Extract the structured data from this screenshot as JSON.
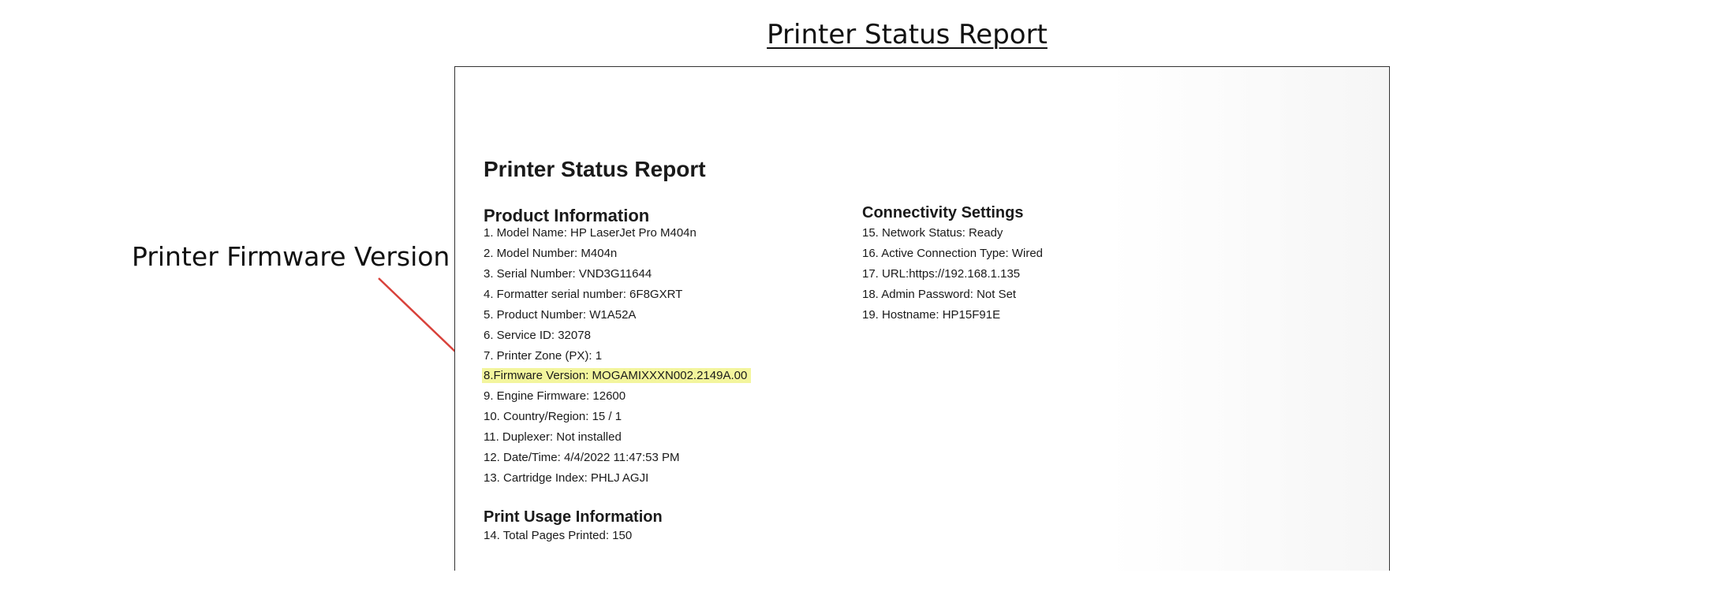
{
  "title": "Printer Status Report",
  "callout": {
    "label": "Printer Firmware Version",
    "arrow_color": "#d8413a"
  },
  "report": {
    "title": "Printer Status Report",
    "product_information": {
      "heading": "Product Information",
      "lines": [
        "1. Model Name: HP LaserJet Pro M404n",
        "2. Model Number: M404n",
        "3. Serial Number: VND3G11644",
        "4. Formatter serial number: 6F8GXRT",
        "5. Product Number: W1A52A",
        "6. Service ID: 32078",
        "7. Printer Zone (PX): 1",
        "8.Firmware Version: MOGAMIXXXN002.2149A.00",
        "9. Engine Firmware: 12600",
        "10. Country/Region: 15  / 1",
        "11. Duplexer: Not installed",
        "12. Date/Time: 4/4/2022 11:47:53 PM",
        "13. Cartridge Index: PHLJ AGJI"
      ]
    },
    "print_usage": {
      "heading": "Print Usage Information",
      "lines": [
        "14. Total Pages Printed: 150"
      ]
    },
    "connectivity": {
      "heading": "Connectivity Settings",
      "lines": [
        "15. Network Status: Ready",
        "16. Active Connection Type: Wired",
        "17. URL:https://192.168.1.135",
        "18. Admin Password: Not Set",
        "19. Hostname: HP15F91E"
      ]
    },
    "highlight_color": "#f3f59d"
  }
}
